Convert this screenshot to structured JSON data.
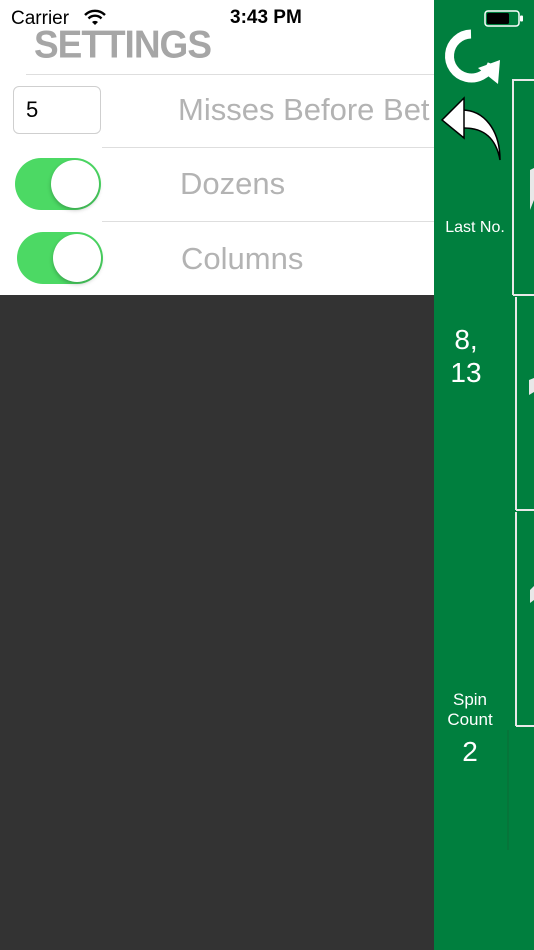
{
  "status_bar": {
    "carrier": "Carrier",
    "time": "3:43 PM"
  },
  "settings": {
    "title": "SETTINGS",
    "misses_input_value": "5",
    "misses_label": "Misses Before Bet",
    "dozens_label": "Dozens",
    "dozens_enabled": true,
    "columns_label": "Columns",
    "columns_enabled": true
  },
  "side_panel": {
    "last_no_label": "Last No.",
    "last_no_line1": "8,",
    "last_no_line2": "13",
    "spin_count_line1": "Spin",
    "spin_count_line2": "Count",
    "spin_count_value": "2"
  },
  "icons": {
    "refresh": "refresh-icon",
    "undo": "undo-arrow-icon",
    "wifi": "wifi-icon",
    "battery": "battery-icon"
  },
  "colors": {
    "felt_green": "#007f3e",
    "toggle_on": "#4cd964",
    "dark_background": "#333333",
    "label_gray": "#b3b3b3"
  }
}
